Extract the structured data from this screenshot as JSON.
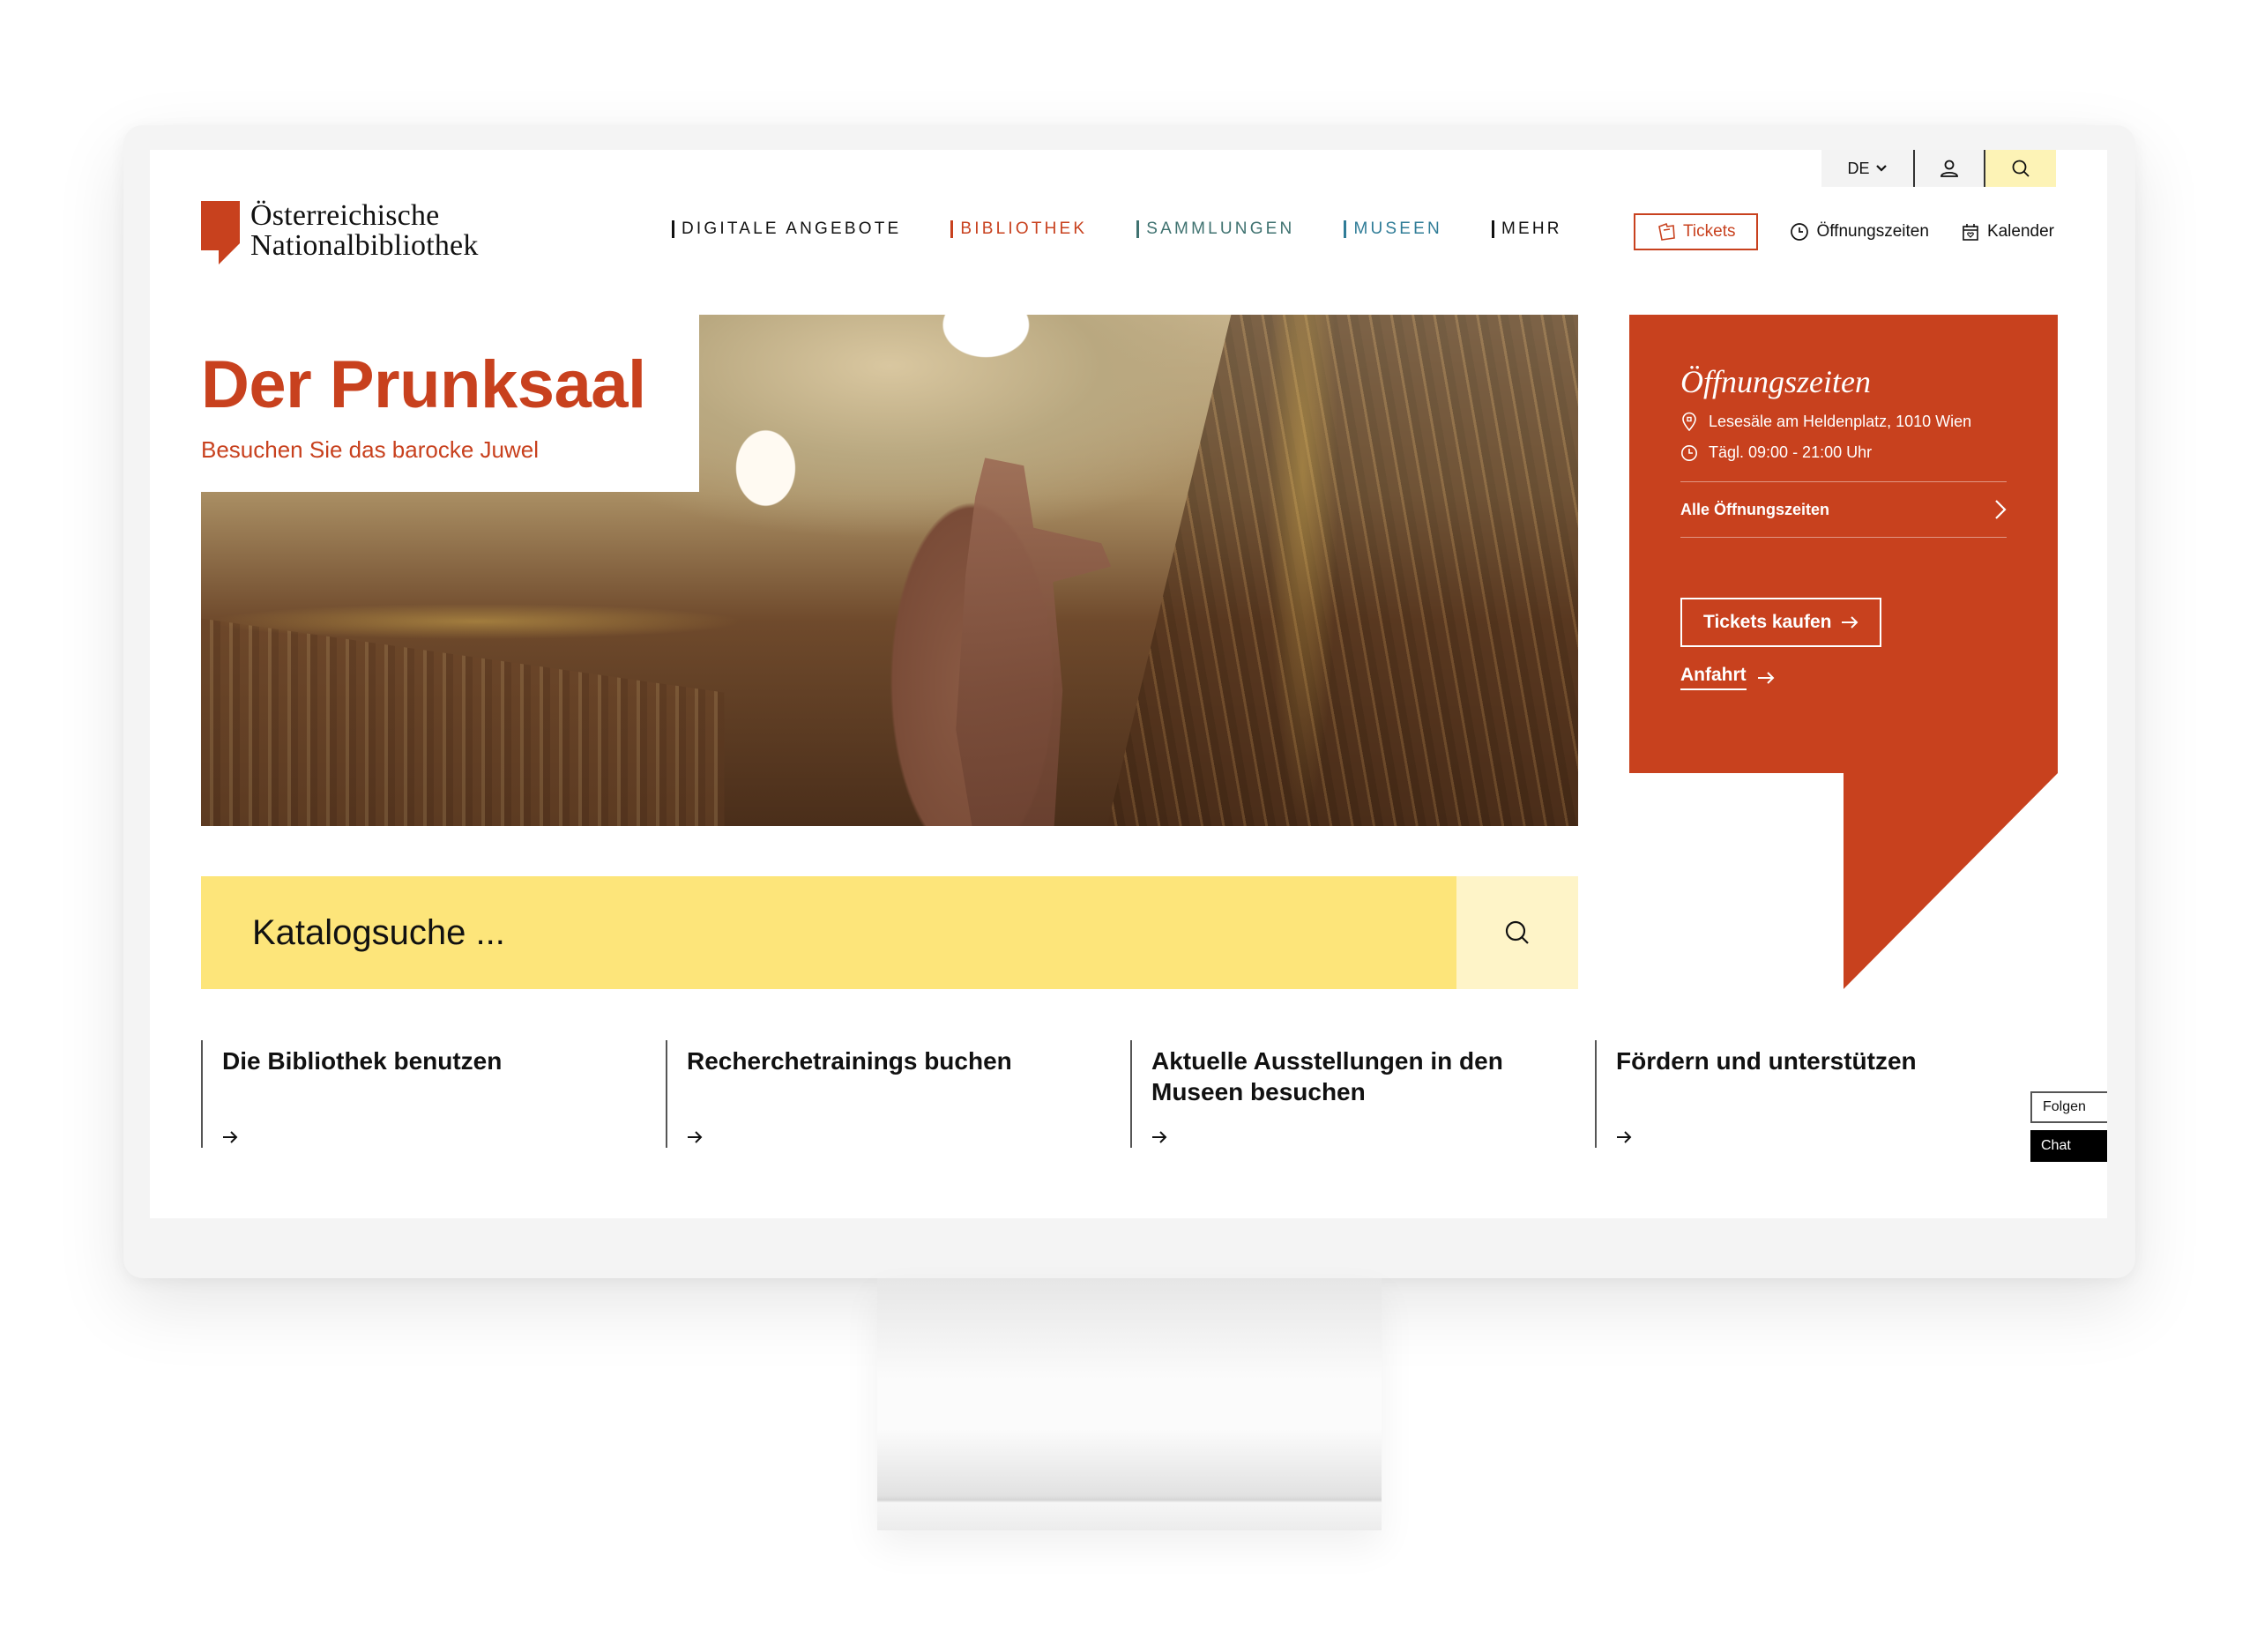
{
  "site": {
    "logo_line1": "Österreichische",
    "logo_line2": "Nationalbibliothek",
    "brand_color": "#c8411e",
    "accent_yellow": "#fde57a"
  },
  "utility": {
    "language": "DE",
    "language_icon": "chevron-down-icon",
    "user_icon": "user-icon",
    "search_icon": "search-icon"
  },
  "nav": {
    "items": [
      {
        "label": "DIGITALE ANGEBOTE",
        "color": "#111111"
      },
      {
        "label": "BIBLIOTHEK",
        "color": "#c8411e"
      },
      {
        "label": "SAMMLUNGEN",
        "color": "#3f7270"
      },
      {
        "label": "MUSEEN",
        "color": "#2f7c97"
      },
      {
        "label": "MEHR",
        "color": "#111111"
      }
    ],
    "tickets_label": "Tickets",
    "hours_label": "Öffnungszeiten",
    "calendar_label": "Kalender"
  },
  "hero": {
    "title": "Der Prunksaal",
    "subtitle": "Besuchen Sie das barocke Juwel",
    "image_alt": "Prunksaal with baroque ceiling fresco and statue"
  },
  "hours": {
    "title": "Öffnungszeiten",
    "location": "Lesesäle am Heldenplatz, 1010 Wien",
    "times": "Tägl. 09:00 - 21:00 Uhr",
    "all_link": "Alle Öffnungszeiten",
    "buy_button": "Tickets kaufen",
    "directions_link": "Anfahrt"
  },
  "search": {
    "placeholder": "Katalogsuche ..."
  },
  "teasers": [
    {
      "title": "Die Bibliothek benutzen"
    },
    {
      "title": "Recherchetrainings buchen"
    },
    {
      "title": "Aktuelle Ausstellungen in den Museen besuchen"
    },
    {
      "title": "Fördern und unterstützen"
    }
  ],
  "side": {
    "follow_label": "Folgen",
    "chat_label": "Chat"
  }
}
